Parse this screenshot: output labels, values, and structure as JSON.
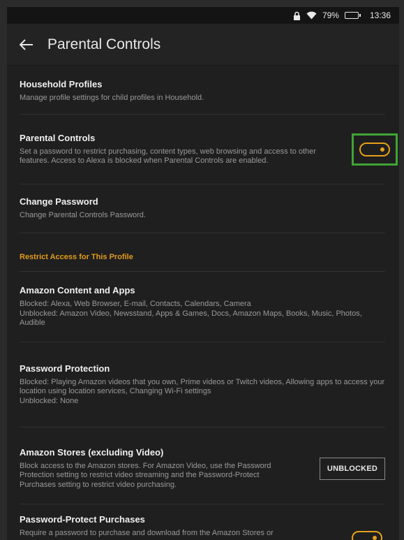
{
  "status": {
    "battery": "79%",
    "time": "13:36"
  },
  "appbar": {
    "title": "Parental Controls"
  },
  "rows": {
    "household": {
      "title": "Household Profiles",
      "desc": "Manage profile settings for child profiles in Household."
    },
    "parental": {
      "title": "Parental Controls",
      "desc": "Set a password to restrict purchasing, content types, web browsing and access to other features. Access to Alexa is blocked when Parental Controls are enabled.",
      "toggle_on": true
    },
    "change_password": {
      "title": "Change Password",
      "desc": "Change Parental Controls Password."
    },
    "content_apps": {
      "title": "Amazon Content and Apps",
      "desc1": "Blocked: Alexa, Web Browser, E-mail, Contacts, Calendars, Camera",
      "desc2": "Unblocked: Amazon Video, Newsstand, Apps & Games, Docs, Amazon Maps, Books, Music, Photos, Audible"
    },
    "password_protection": {
      "title": "Password Protection",
      "desc1": "Blocked: Playing Amazon videos that you own, Prime videos or Twitch videos, Allowing apps to access your location using location services, Changing Wi-Fi settings",
      "desc2": "Unblocked: None"
    },
    "stores": {
      "title": "Amazon Stores (excluding Video)",
      "desc": "Block access to the Amazon stores. For Amazon Video, use the Password Protection setting to restrict video streaming and the Password-Protect Purchases setting to restrict video purchasing.",
      "button": "UNBLOCKED"
    },
    "protect_purchases": {
      "title": "Password-Protect Purchases",
      "desc": "Require a password to purchase and download from the Amazon Stores or",
      "toggle_on": true
    }
  },
  "section": {
    "restrict_header": "Restrict Access for This Profile"
  },
  "colors": {
    "accent": "#e6a11a",
    "highlight": "#3fa535",
    "background": "#1f1f1f"
  }
}
